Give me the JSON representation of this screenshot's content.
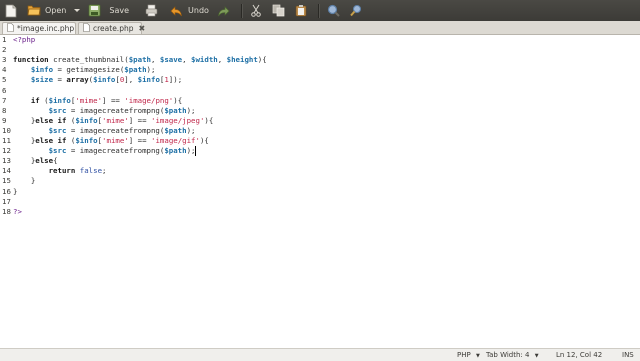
{
  "toolbar": {
    "open_label": "Open",
    "save_label": "Save",
    "undo_label": "Undo"
  },
  "tabs": [
    {
      "label": "*image.inc.php",
      "active": true
    },
    {
      "label": "create.php",
      "active": false
    }
  ],
  "editor": {
    "line_numbers": [
      "1",
      "2",
      "3",
      "4",
      "5",
      "6",
      "7",
      "8",
      "9",
      "10",
      "11",
      "12",
      "13",
      "14",
      "15",
      "16",
      "17",
      "18"
    ],
    "lines": [
      "<?php",
      "",
      "function create_thumbnail($path, $save, $width, $height){",
      "    $info = getimagesize($path);",
      "    $size = array($info[0], $info[1]);",
      "",
      "    if ($info['mime'] == 'image/png'){",
      "        $src = imagecreatefrompng($path);",
      "    }else if ($info['mime'] == 'image/jpeg'){",
      "        $src = imagecreatefrompng($path);",
      "    }else if ($info['mime'] == 'image/gif'){",
      "        $src = imagecreatefrompng($path);",
      "    }else{",
      "        return false;",
      "    }",
      "}",
      "",
      "?>"
    ]
  },
  "statusbar": {
    "language": "PHP",
    "tab_width": "Tab Width: 4",
    "position": "Ln 12, Col 42",
    "mode": "INS"
  }
}
